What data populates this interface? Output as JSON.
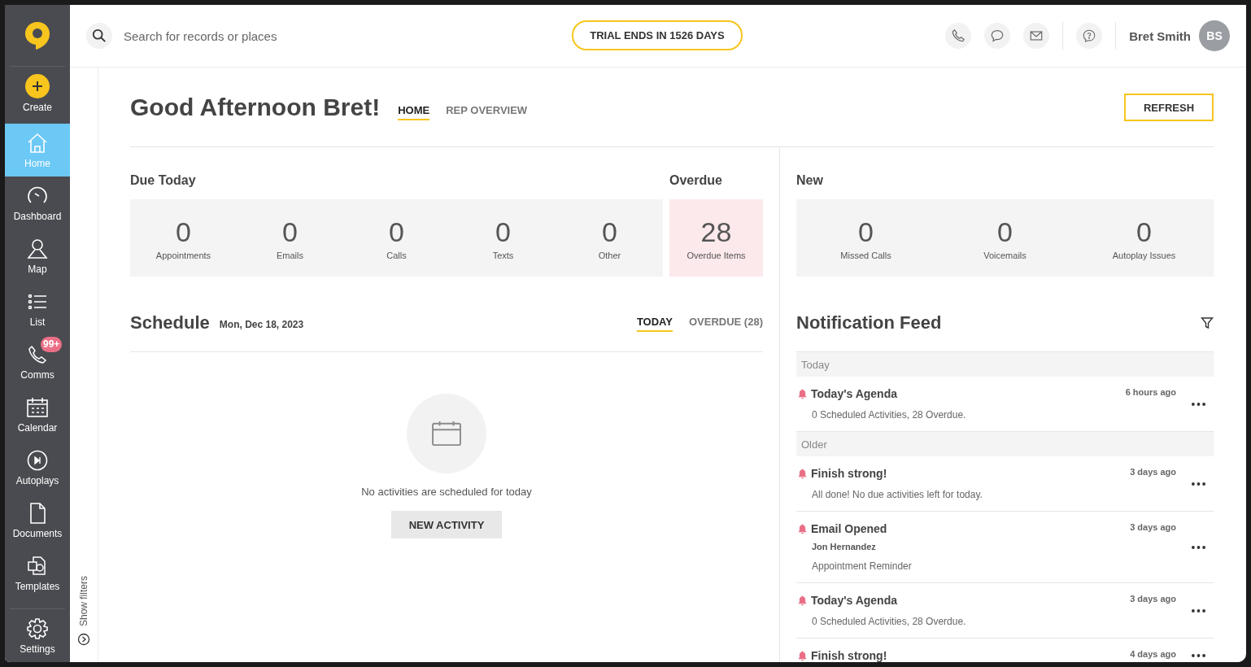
{
  "sidebar": {
    "items": [
      {
        "label": "Create",
        "selected": false
      },
      {
        "label": "Home",
        "selected": true
      },
      {
        "label": "Dashboard",
        "selected": false
      },
      {
        "label": "Map",
        "selected": false
      },
      {
        "label": "List",
        "selected": false
      },
      {
        "label": "Comms",
        "selected": false,
        "badge": "99+"
      },
      {
        "label": "Calendar",
        "selected": false
      },
      {
        "label": "Autoplays",
        "selected": false
      },
      {
        "label": "Documents",
        "selected": false
      },
      {
        "label": "Templates",
        "selected": false
      },
      {
        "label": "Settings",
        "selected": false
      }
    ]
  },
  "header": {
    "search": {
      "placeholder": "Search for records or places"
    },
    "trial": "TRIAL ENDS IN 1526 DAYS",
    "user": {
      "name": "Bret Smith",
      "initials": "BS"
    }
  },
  "filters_toggle": "Show filters",
  "page": {
    "greeting": "Good Afternoon Bret!",
    "tabs": [
      {
        "label": "HOME",
        "selected": true
      },
      {
        "label": "REP OVERVIEW",
        "selected": false
      }
    ],
    "refresh": "REFRESH"
  },
  "due_today": {
    "title": "Due Today",
    "stats": [
      {
        "value": "0",
        "label": "Appointments"
      },
      {
        "value": "0",
        "label": "Emails"
      },
      {
        "value": "0",
        "label": "Calls"
      },
      {
        "value": "0",
        "label": "Texts"
      },
      {
        "value": "0",
        "label": "Other"
      }
    ]
  },
  "overdue": {
    "title": "Overdue",
    "value": "28",
    "label": "Overdue Items"
  },
  "new": {
    "title": "New",
    "stats": [
      {
        "value": "0",
        "label": "Missed Calls"
      },
      {
        "value": "0",
        "label": "Voicemails"
      },
      {
        "value": "0",
        "label": "Autoplay Issues"
      }
    ]
  },
  "schedule": {
    "title": "Schedule",
    "date": "Mon, Dec 18, 2023",
    "tabs": [
      {
        "label": "TODAY",
        "selected": true
      },
      {
        "label": "OVERDUE (28)",
        "selected": false
      }
    ],
    "empty_text": "No activities are scheduled for today",
    "new_activity": "NEW ACTIVITY"
  },
  "feed": {
    "title": "Notification Feed",
    "groups": [
      {
        "label": "Today",
        "items": [
          {
            "title": "Today's Agenda",
            "time": "6 hours ago",
            "body": "0 Scheduled Activities, 28 Overdue."
          }
        ]
      },
      {
        "label": "Older",
        "items": [
          {
            "title": "Finish strong!",
            "time": "3 days ago",
            "body": "All done! No due activities left for today."
          },
          {
            "title": "Email Opened",
            "time": "3 days ago",
            "contact": "Jon Hernandez",
            "body": "Appointment Reminder"
          },
          {
            "title": "Today's Agenda",
            "time": "3 days ago",
            "body": "0 Scheduled Activities, 28 Overdue."
          },
          {
            "title": "Finish strong!",
            "time": "4 days ago"
          }
        ]
      }
    ]
  }
}
